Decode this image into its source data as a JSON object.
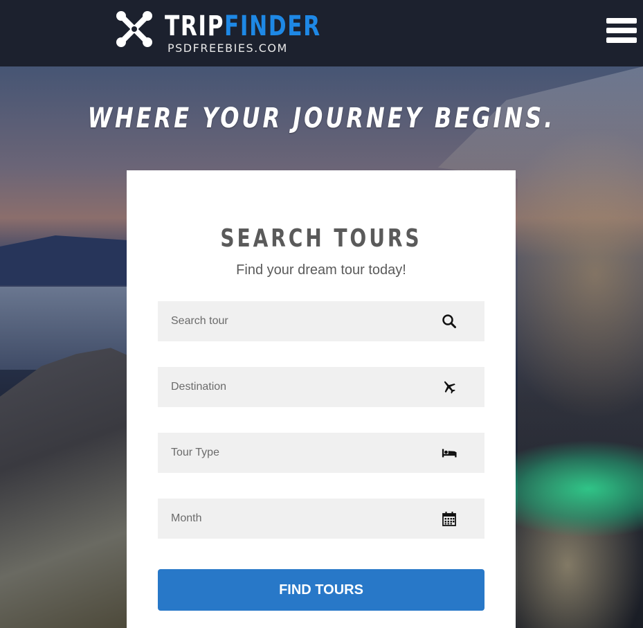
{
  "brand": {
    "name_part1": "TRIP",
    "name_part2": "FINDER",
    "subtitle": "PSDFREEBIES.COM",
    "logo_icon": "joomla-logo-icon"
  },
  "header": {
    "menu_icon": "hamburger-menu-icon"
  },
  "hero": {
    "tagline": "WHERE YOUR JOURNEY BEGINS."
  },
  "search": {
    "title": "SEARCH TOURS",
    "subtitle": "Find your dream tour today!",
    "fields": [
      {
        "placeholder": "Search tour",
        "icon": "search-icon"
      },
      {
        "placeholder": "Destination",
        "icon": "airplane-icon"
      },
      {
        "placeholder": "Tour Type",
        "icon": "bed-icon"
      },
      {
        "placeholder": "Month",
        "icon": "calendar-icon"
      }
    ],
    "button_label": "FIND TOURS"
  },
  "colors": {
    "header_bg": "#1c212e",
    "accent_blue": "#1e88e5",
    "button_blue": "#2878c8",
    "field_bg": "#f0f0f0",
    "title_gray": "#5a5a5a"
  }
}
